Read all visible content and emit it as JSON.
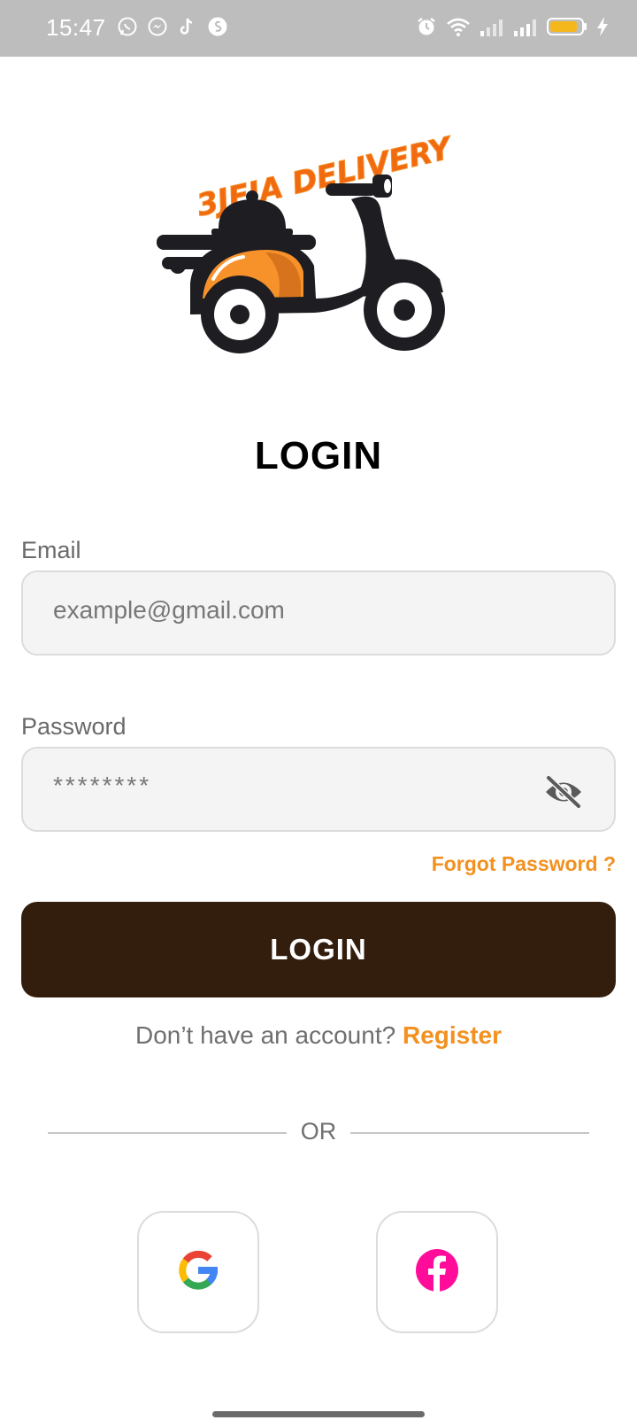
{
  "status_bar": {
    "time": "15:47",
    "app_icons": [
      "whatsapp-icon",
      "messenger-icon",
      "tiktok-icon",
      "shazam-icon"
    ],
    "system_icons": [
      "alarm-icon",
      "wifi-icon",
      "signal-icon",
      "signal-icon",
      "battery-icon",
      "charging-icon"
    ]
  },
  "logo": {
    "text": "3JEJA DELIVERY",
    "icon": "scooter-delivery-logo"
  },
  "page": {
    "title": "LOGIN"
  },
  "form": {
    "email_label": "Email",
    "email_placeholder": "example@gmail.com",
    "password_label": "Password",
    "password_value": "********",
    "password_toggle_icon": "eye-off-icon",
    "forgot_password": "Forgot Password ?",
    "login_button": "LOGIN"
  },
  "register": {
    "prompt": "Don’t have an account?",
    "link": "Register"
  },
  "divider": {
    "text": "OR"
  },
  "social": [
    {
      "name": "google",
      "icon": "google-icon"
    },
    {
      "name": "facebook",
      "icon": "facebook-icon"
    }
  ],
  "colors": {
    "accent": "#f29120",
    "button_dark": "#331e0e",
    "status_bar": "#bdbdbd",
    "facebook": "#ff0d9a"
  }
}
